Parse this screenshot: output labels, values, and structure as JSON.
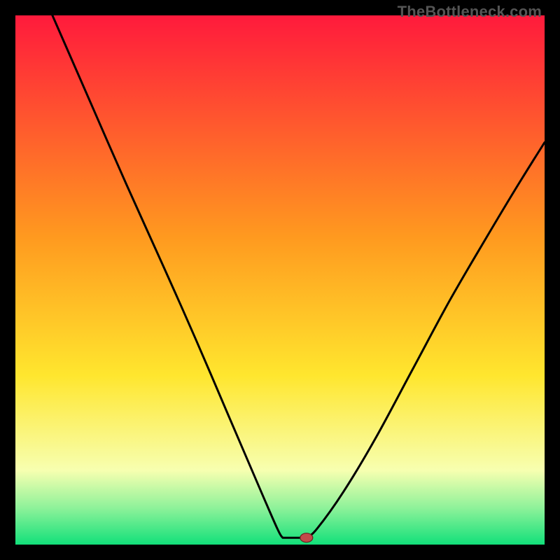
{
  "site_label": "TheBottleneck.com",
  "colors": {
    "frame": "#000000",
    "gradient_top": "#ff1a3c",
    "gradient_mid1": "#ff9a1f",
    "gradient_mid2": "#ffe62e",
    "gradient_low": "#f7ffb0",
    "gradient_green1": "#8ff29a",
    "gradient_green2": "#12e07a",
    "line": "#000000",
    "marker_fill": "#c24a4a",
    "marker_stroke": "#6a2020"
  },
  "chart_data": {
    "type": "line",
    "title": "",
    "xlabel": "",
    "ylabel": "",
    "xlim": [
      0,
      100
    ],
    "ylim": [
      0,
      100
    ],
    "curve_left": [
      {
        "x": 7,
        "y": 100
      },
      {
        "x": 14,
        "y": 84
      },
      {
        "x": 21,
        "y": 68
      },
      {
        "x": 28,
        "y": 52.5
      },
      {
        "x": 34,
        "y": 39
      },
      {
        "x": 40,
        "y": 25
      },
      {
        "x": 46,
        "y": 11
      },
      {
        "x": 49.5,
        "y": 3
      },
      {
        "x": 50.5,
        "y": 1.3
      }
    ],
    "flat": [
      {
        "x": 50.5,
        "y": 1.3
      },
      {
        "x": 55,
        "y": 1.3
      }
    ],
    "curve_right": [
      {
        "x": 55,
        "y": 1.3
      },
      {
        "x": 57,
        "y": 3
      },
      {
        "x": 62,
        "y": 10
      },
      {
        "x": 68,
        "y": 20
      },
      {
        "x": 75,
        "y": 33
      },
      {
        "x": 82,
        "y": 46
      },
      {
        "x": 89,
        "y": 58
      },
      {
        "x": 95,
        "y": 68
      },
      {
        "x": 100,
        "y": 76
      }
    ],
    "marker": {
      "x": 55,
      "y": 1.3
    }
  }
}
